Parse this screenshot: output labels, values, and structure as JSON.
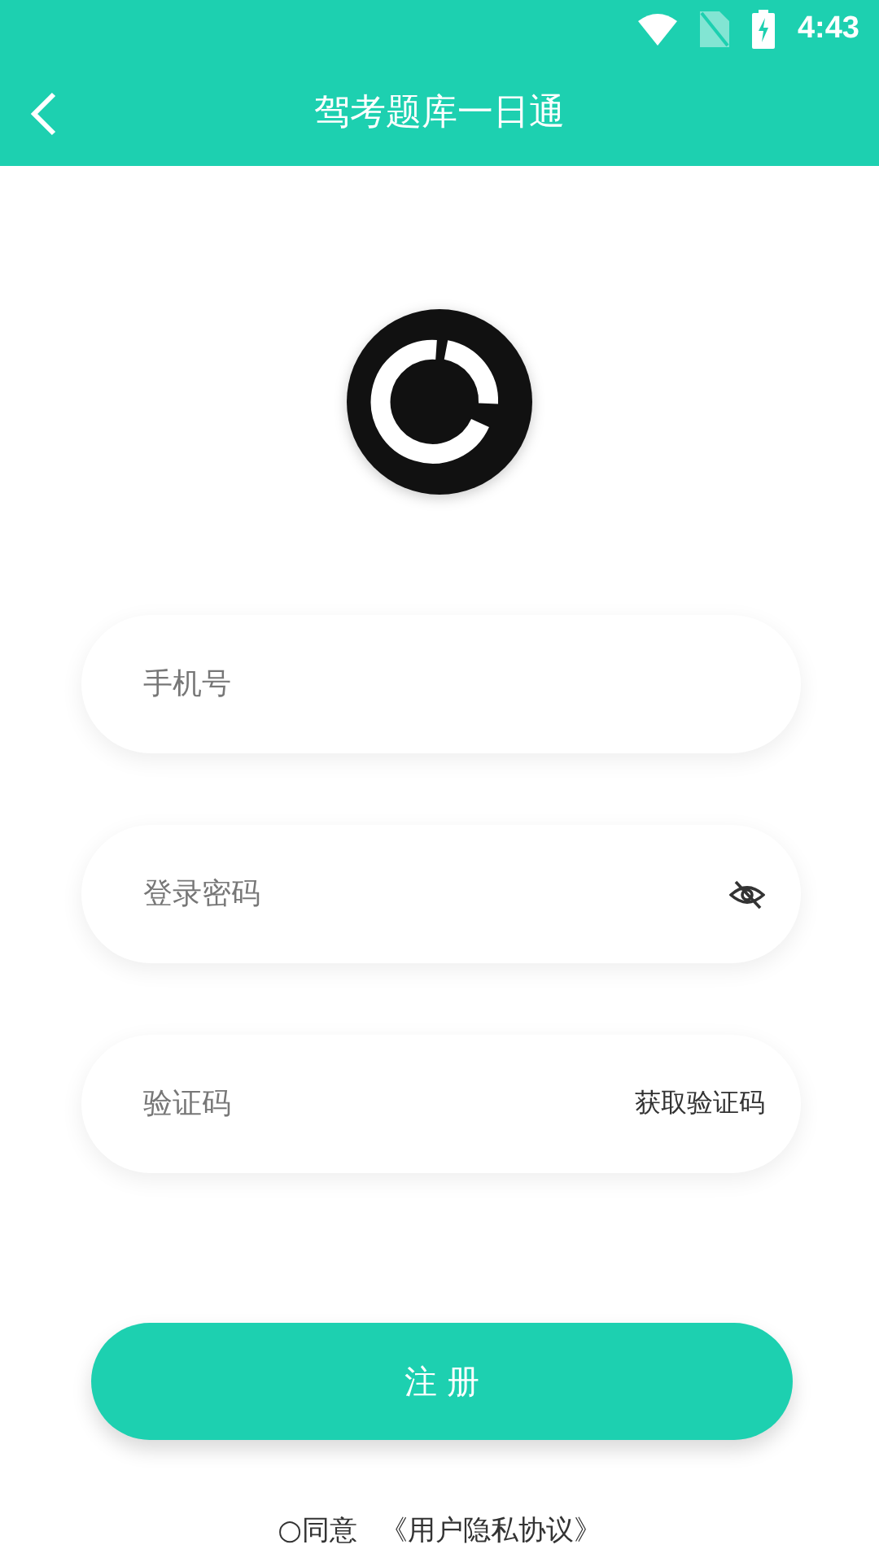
{
  "status_bar": {
    "time": "4:43"
  },
  "header": {
    "title": "驾考题库一日通"
  },
  "fields": [
    {
      "kind": "text",
      "placeholder": "手机号"
    },
    {
      "kind": "password",
      "placeholder": "登录密码"
    },
    {
      "kind": "code",
      "placeholder": "验证码",
      "action": "获取验证码"
    }
  ],
  "submit": "注 册",
  "agreement": {
    "prefix": "○同意",
    "link": "《用户隐私协议》"
  }
}
